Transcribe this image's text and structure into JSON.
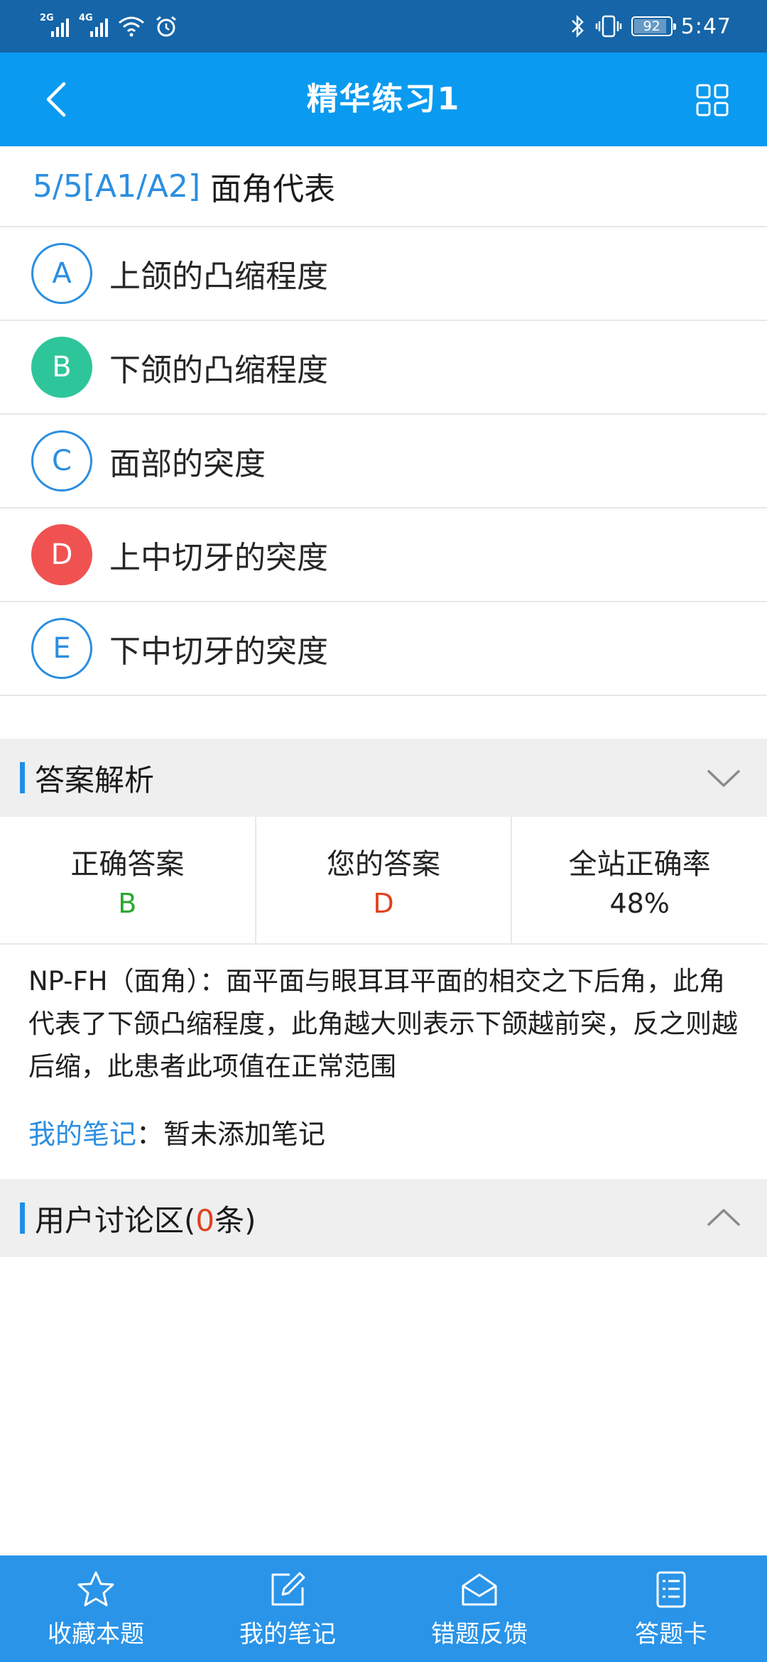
{
  "status_bar": {
    "sim1": "2G",
    "sim2": "4G",
    "battery": "92",
    "battery_level_percent": 92,
    "time": "5:47",
    "icons": [
      "signal-icon",
      "wifi-icon",
      "alarm-icon",
      "bluetooth-icon",
      "vibrate-icon",
      "battery-icon"
    ]
  },
  "header": {
    "title": "精华练习1",
    "back_icon": "chevron-left-icon",
    "grid_icon": "grid-icon"
  },
  "question": {
    "number": "5/5[A1/A2]",
    "text": "面角代表"
  },
  "options": [
    {
      "letter": "A",
      "text": "上颌的凸缩程度",
      "state": "normal"
    },
    {
      "letter": "B",
      "text": "下颌的凸缩程度",
      "state": "correct"
    },
    {
      "letter": "C",
      "text": "面部的突度",
      "state": "normal"
    },
    {
      "letter": "D",
      "text": "上中切牙的突度",
      "state": "wrong"
    },
    {
      "letter": "E",
      "text": "下中切牙的突度",
      "state": "normal"
    }
  ],
  "answer_section": {
    "title": "答案解析",
    "toggle_icon": "chevron-down-icon",
    "correct_label": "正确答案",
    "correct_value": "B",
    "yours_label": "您的答案",
    "yours_value": "D",
    "rate_label": "全站正确率",
    "rate_value": "48%",
    "analysis": "NP-FH（面角）：面平面与眼耳耳平面的相交之下后角，此角代表了下颌凸缩程度，此角越大则表示下颌越前突，反之则越后缩，此患者此项值在正常范围",
    "notes_label": "我的笔记",
    "notes_sep": "：",
    "notes_value": "暂未添加笔记"
  },
  "discussion": {
    "title_prefix": "用户讨论区(",
    "count": "0",
    "title_suffix": "条)",
    "toggle_icon": "chevron-up-icon"
  },
  "bottom_nav": [
    {
      "label": "收藏本题",
      "icon": "star-icon"
    },
    {
      "label": "我的笔记",
      "icon": "edit-icon"
    },
    {
      "label": "错题反馈",
      "icon": "envelope-icon"
    },
    {
      "label": "答题卡",
      "icon": "answer-card-icon"
    }
  ],
  "colors": {
    "status_bar": "#1565a8",
    "header": "#0a9af0",
    "accent": "#2b8ee0",
    "correct": "#2fc59b",
    "wrong": "#f05252",
    "nav": "#2a94e8"
  }
}
